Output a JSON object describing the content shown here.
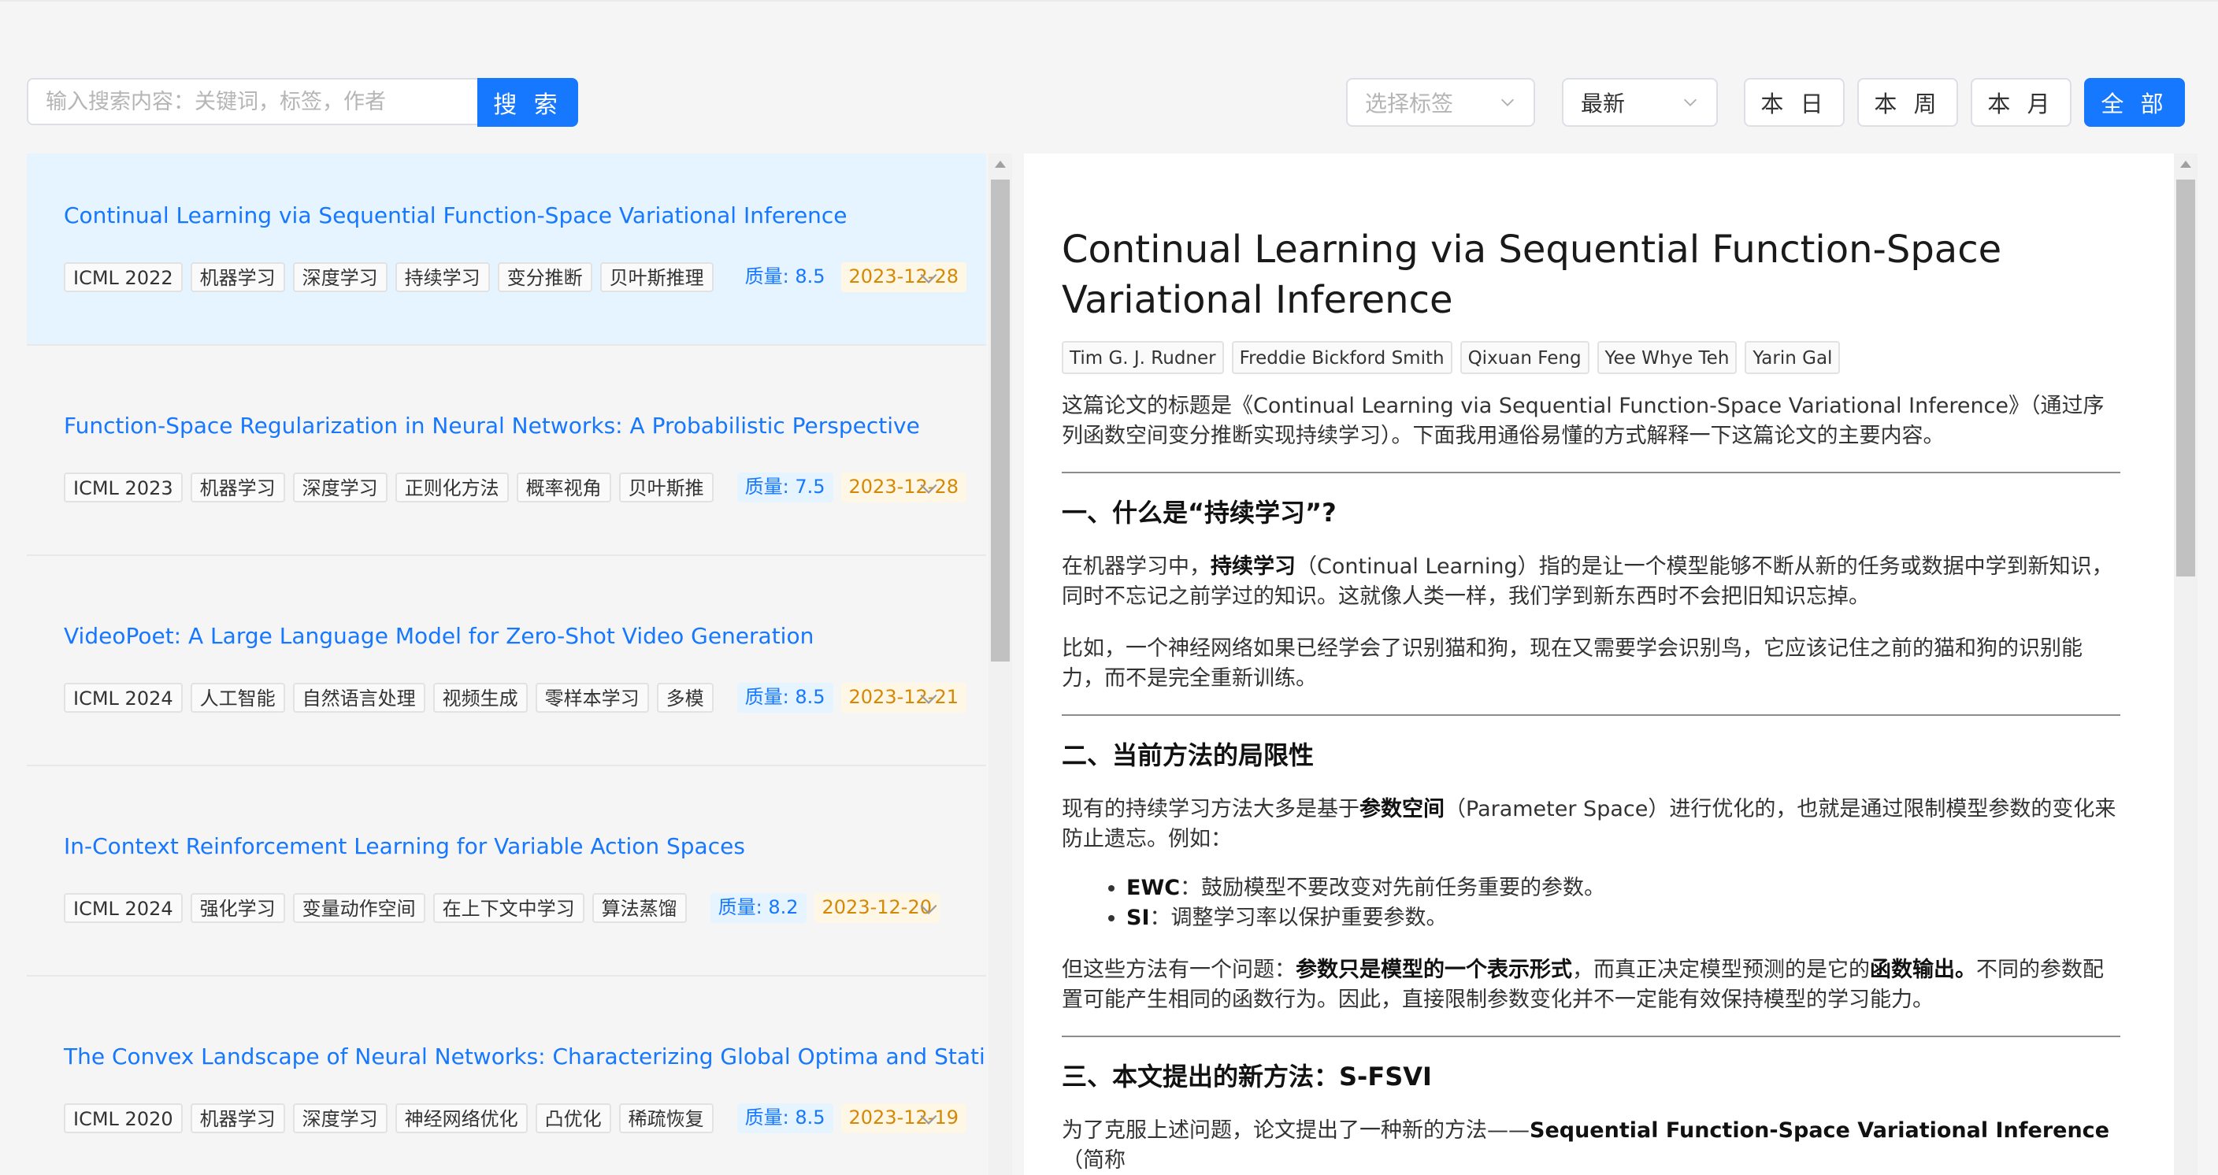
{
  "toolbar": {
    "search_placeholder": "输入搜索内容：关键词，标签，作者",
    "search_button": "搜 索",
    "tag_select_placeholder": "选择标签",
    "sort_select_value": "最新",
    "range_buttons": [
      "本 日",
      "本 周",
      "本 月",
      "全 部"
    ],
    "active_range": "全 部"
  },
  "papers": [
    {
      "title": "Continual Learning via Sequential Function-Space Variational Inference",
      "venue": "ICML 2022",
      "tags": [
        "机器学习",
        "深度学习",
        "持续学习",
        "变分推断",
        "贝叶斯推理"
      ],
      "quality": "质量: 8.5",
      "date": "2023-12-28",
      "selected": true
    },
    {
      "title": "Function-Space Regularization in Neural Networks: A Probabilistic Perspective",
      "venue": "ICML 2023",
      "tags": [
        "机器学习",
        "深度学习",
        "正则化方法",
        "概率视角",
        "贝叶斯推"
      ],
      "quality": "质量: 7.5",
      "date": "2023-12-28",
      "selected": false
    },
    {
      "title": "VideoPoet: A Large Language Model for Zero-Shot Video Generation",
      "venue": "ICML 2024",
      "tags": [
        "人工智能",
        "自然语言处理",
        "视频生成",
        "零样本学习",
        "多模"
      ],
      "quality": "质量: 8.5",
      "date": "2023-12-21",
      "selected": false
    },
    {
      "title": "In-Context Reinforcement Learning for Variable Action Spaces",
      "venue": "ICML 2024",
      "tags": [
        "强化学习",
        "变量动作空间",
        "在上下文中学习",
        "算法蒸馏"
      ],
      "quality": "质量: 8.2",
      "date": "2023-12-20",
      "selected": false
    },
    {
      "title": "The Convex Landscape of Neural Networks: Characterizing Global Optima and Stationary",
      "venue": "ICML 2020",
      "tags": [
        "机器学习",
        "深度学习",
        "神经网络优化",
        "凸优化",
        "稀疏恢复"
      ],
      "quality": "质量: 8.5",
      "date": "2023-12-19",
      "selected": false
    }
  ],
  "detail": {
    "title": "Continual Learning via Sequential Function-Space Variational Inference",
    "authors": [
      "Tim G. J. Rudner",
      "Freddie Bickford Smith",
      "Qixuan Feng",
      "Yee Whye Teh",
      "Yarin Gal"
    ],
    "intro": "这篇论文的标题是《Continual Learning via Sequential Function-Space Variational Inference》（通过序列函数空间变分推断实现持续学习）。下面我用通俗易懂的方式解释一下这篇论文的主要内容。",
    "s1": {
      "heading": "一、什么是“持续学习”?",
      "p1_pre": "在机器学习中，",
      "p1_bold": "持续学习",
      "p1_post": "（Continual Learning）指的是让一个模型能够不断从新的任务或数据中学到新知识，同时不忘记之前学过的知识。这就像人类一样，我们学到新东西时不会把旧知识忘掉。",
      "p2": "比如，一个神经网络如果已经学会了识别猫和狗，现在又需要学会识别鸟，它应该记住之前的猫和狗的识别能力，而不是完全重新训练。"
    },
    "s2": {
      "heading": "二、当前方法的局限性",
      "p1_pre": "现有的持续学习方法大多是基于",
      "p1_bold": "参数空间",
      "p1_post": "（Parameter Space）进行优化的，也就是通过限制模型参数的变化来防止遗忘。例如：",
      "b1_bold": "EWC",
      "b1_text": "：鼓励模型不要改变对先前任务重要的参数。",
      "b2_bold": "SI",
      "b2_text": "：调整学习率以保护重要参数。",
      "p2_pre": "但这些方法有一个问题：",
      "p2_bold1": "参数只是模型的一个表示形式",
      "p2_mid": "，而真正决定模型预测的是它的",
      "p2_bold2": "函数输出。",
      "p2_post": "不同的参数配置可能产生相同的函数行为。因此，直接限制参数变化并不一定能有效保持模型的学习能力。"
    },
    "s3": {
      "heading": "三、本文提出的新方法：S-FSVI",
      "p1_pre": "为了克服上述问题，论文提出了一种新的方法——",
      "p1_bold": "Sequential Function-Space Variational Inference",
      "p1_post": "（简称"
    }
  }
}
